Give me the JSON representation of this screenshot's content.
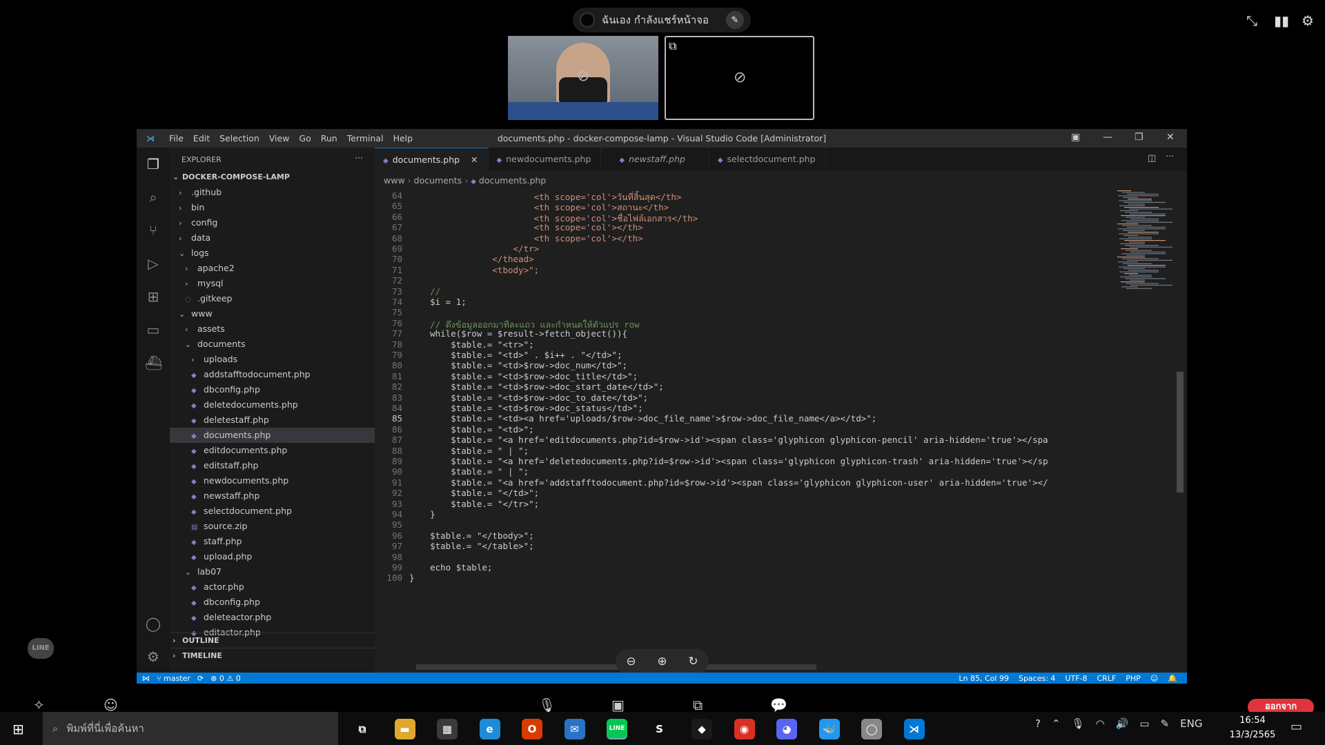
{
  "share": {
    "label": "ฉันเอง กำลังแชร์หน้าจอ"
  },
  "vscode": {
    "window_title": "documents.php - docker-compose-lamp - Visual Studio Code [Administrator]",
    "menu": [
      "File",
      "Edit",
      "Selection",
      "View",
      "Go",
      "Run",
      "Terminal",
      "Help"
    ],
    "sidebar": {
      "header": "EXPLORER",
      "root": "DOCKER-COMPOSE-LAMP",
      "tree": [
        {
          "label": ".github",
          "type": "folder",
          "depth": 1,
          "open": false
        },
        {
          "label": "bin",
          "type": "folder",
          "depth": 1,
          "open": false
        },
        {
          "label": "config",
          "type": "folder",
          "depth": 1,
          "open": false
        },
        {
          "label": "data",
          "type": "folder",
          "depth": 1,
          "open": false
        },
        {
          "label": "logs",
          "type": "folder",
          "depth": 1,
          "open": true
        },
        {
          "label": "apache2",
          "type": "folder",
          "depth": 2,
          "open": false
        },
        {
          "label": "mysql",
          "type": "folder",
          "depth": 2,
          "open": false
        },
        {
          "label": ".gitkeep",
          "type": "file",
          "depth": 2
        },
        {
          "label": "www",
          "type": "folder",
          "depth": 1,
          "open": true
        },
        {
          "label": "assets",
          "type": "folder",
          "depth": 2,
          "open": false
        },
        {
          "label": "documents",
          "type": "folder",
          "depth": 2,
          "open": true
        },
        {
          "label": "uploads",
          "type": "folder",
          "depth": 3,
          "open": false
        },
        {
          "label": "addstafftodocument.php",
          "type": "php",
          "depth": 3
        },
        {
          "label": "dbconfig.php",
          "type": "php",
          "depth": 3
        },
        {
          "label": "deletedocuments.php",
          "type": "php",
          "depth": 3
        },
        {
          "label": "deletestaff.php",
          "type": "php",
          "depth": 3
        },
        {
          "label": "documents.php",
          "type": "php",
          "depth": 3,
          "selected": true
        },
        {
          "label": "editdocuments.php",
          "type": "php",
          "depth": 3
        },
        {
          "label": "editstaff.php",
          "type": "php",
          "depth": 3
        },
        {
          "label": "newdocuments.php",
          "type": "php",
          "depth": 3
        },
        {
          "label": "newstaff.php",
          "type": "php",
          "depth": 3
        },
        {
          "label": "selectdocument.php",
          "type": "php",
          "depth": 3
        },
        {
          "label": "source.zip",
          "type": "zip",
          "depth": 3
        },
        {
          "label": "staff.php",
          "type": "php",
          "depth": 3
        },
        {
          "label": "upload.php",
          "type": "php",
          "depth": 3
        },
        {
          "label": "lab07",
          "type": "folder",
          "depth": 2,
          "open": true
        },
        {
          "label": "actor.php",
          "type": "php",
          "depth": 3
        },
        {
          "label": "dbconfig.php",
          "type": "php",
          "depth": 3
        },
        {
          "label": "deleteactor.php",
          "type": "php",
          "depth": 3
        },
        {
          "label": "editactor.php",
          "type": "php",
          "depth": 3
        }
      ],
      "outline": "OUTLINE",
      "timeline": "TIMELINE"
    },
    "tabs": [
      {
        "label": "documents.php",
        "active": true
      },
      {
        "label": "newdocuments.php",
        "active": false
      },
      {
        "label": "newstaff.php",
        "active": false
      },
      {
        "label": "selectdocument.php",
        "active": false
      }
    ],
    "breadcrumb": [
      "www",
      "documents",
      "documents.php"
    ],
    "code_lines": [
      {
        "n": "64",
        "text": "                        <th scope='col'>วันที่สิ้นสุด</th>"
      },
      {
        "n": "65",
        "text": "                        <th scope='col'>สถานะ</th>"
      },
      {
        "n": "66",
        "text": "                        <th scope='col'>ชื่อไฟล์เอกสาร</th>"
      },
      {
        "n": "67",
        "text": "                        <th scope='col'></th>"
      },
      {
        "n": "68",
        "text": "                        <th scope='col'></th>"
      },
      {
        "n": "69",
        "text": "                    </tr>"
      },
      {
        "n": "70",
        "text": "                </thead>"
      },
      {
        "n": "71",
        "text": "                <tbody>\";"
      },
      {
        "n": "72",
        "text": ""
      },
      {
        "n": "73",
        "text": "    //"
      },
      {
        "n": "74",
        "text": "    $i = 1;"
      },
      {
        "n": "75",
        "text": ""
      },
      {
        "n": "76",
        "text": "    // ดึงข้อมูลออกมาทีละแถว และกำหนดให้ตัวแปร row"
      },
      {
        "n": "77",
        "text": "    while($row = $result->fetch_object()){"
      },
      {
        "n": "78",
        "text": "        $table.= \"<tr>\";"
      },
      {
        "n": "79",
        "text": "        $table.= \"<td>\" . $i++ . \"</td>\";"
      },
      {
        "n": "80",
        "text": "        $table.= \"<td>$row->doc_num</td>\";"
      },
      {
        "n": "81",
        "text": "        $table.= \"<td>$row->doc_title</td>\";"
      },
      {
        "n": "82",
        "text": "        $table.= \"<td>$row->doc_start_date</td>\";"
      },
      {
        "n": "83",
        "text": "        $table.= \"<td>$row->doc_to_date</td>\";"
      },
      {
        "n": "84",
        "text": "        $table.= \"<td>$row->doc_status</td>\";"
      },
      {
        "n": "85",
        "text": "        $table.= \"<td><a href='uploads/$row->doc_file_name'>$row->doc_file_name</a></td>\";"
      },
      {
        "n": "86",
        "text": "        $table.= \"<td>\";"
      },
      {
        "n": "87",
        "text": "        $table.= \"<a href='editdocuments.php?id=$row->id'><span class='glyphicon glyphicon-pencil' aria-hidden='true'></spa"
      },
      {
        "n": "88",
        "text": "        $table.= \" | \";"
      },
      {
        "n": "89",
        "text": "        $table.= \"<a href='deletedocuments.php?id=$row->id'><span class='glyphicon glyphicon-trash' aria-hidden='true'></sp"
      },
      {
        "n": "90",
        "text": "        $table.= \" | \";"
      },
      {
        "n": "91",
        "text": "        $table.= \"<a href='addstafftodocument.php?id=$row->id'><span class='glyphicon glyphicon-user' aria-hidden='true'></"
      },
      {
        "n": "92",
        "text": "        $table.= \"</td>\";"
      },
      {
        "n": "93",
        "text": "        $table.= \"</tr>\";"
      },
      {
        "n": "94",
        "text": "    }"
      },
      {
        "n": "95",
        "text": ""
      },
      {
        "n": "96",
        "text": "    $table.= \"</tbody>\";"
      },
      {
        "n": "97",
        "text": "    $table.= \"</table>\";"
      },
      {
        "n": "98",
        "text": ""
      },
      {
        "n": "99",
        "text": "    echo $table;"
      },
      {
        "n": "100",
        "text": "}"
      }
    ],
    "status": {
      "branch": "master",
      "problems": "⊗ 0 ⚠ 0",
      "cursor": "Ln 85, Col 99",
      "spaces": "Spaces: 4",
      "encoding": "UTF-8",
      "eol": "CRLF",
      "language": "PHP"
    }
  },
  "call": {
    "end_label": "ออกจาก"
  },
  "taskbar": {
    "search_placeholder": "พิมพ์ที่นี่เพื่อค้นหา",
    "lang": "ENG",
    "time": "16:54",
    "date": "13/3/2565",
    "apps": [
      {
        "name": "task-view",
        "glyph": "⧉",
        "color": "#0d0d0d"
      },
      {
        "name": "file-explorer",
        "glyph": "▬",
        "color": "#e0a82e"
      },
      {
        "name": "store",
        "glyph": "▦",
        "color": "#3a3a3a"
      },
      {
        "name": "edge",
        "glyph": "e",
        "color": "#1f8ad6"
      },
      {
        "name": "office",
        "glyph": "O",
        "color": "#d83b01"
      },
      {
        "name": "mail",
        "glyph": "✉",
        "color": "#2a72c4"
      },
      {
        "name": "line",
        "glyph": "LINE",
        "color": "#06c755"
      },
      {
        "name": "app-s",
        "glyph": "S",
        "color": "#0d0d0d"
      },
      {
        "name": "binance",
        "glyph": "◆",
        "color": "#1a1a1a"
      },
      {
        "name": "chrome",
        "glyph": "◉",
        "color": "#d93025"
      },
      {
        "name": "discord",
        "glyph": "◕",
        "color": "#5865f2"
      },
      {
        "name": "docker",
        "glyph": "🐳",
        "color": "#2496ed"
      },
      {
        "name": "app-white",
        "glyph": "◯",
        "color": "#888"
      },
      {
        "name": "vscode",
        "glyph": "⋊",
        "color": "#0078d4"
      }
    ]
  }
}
